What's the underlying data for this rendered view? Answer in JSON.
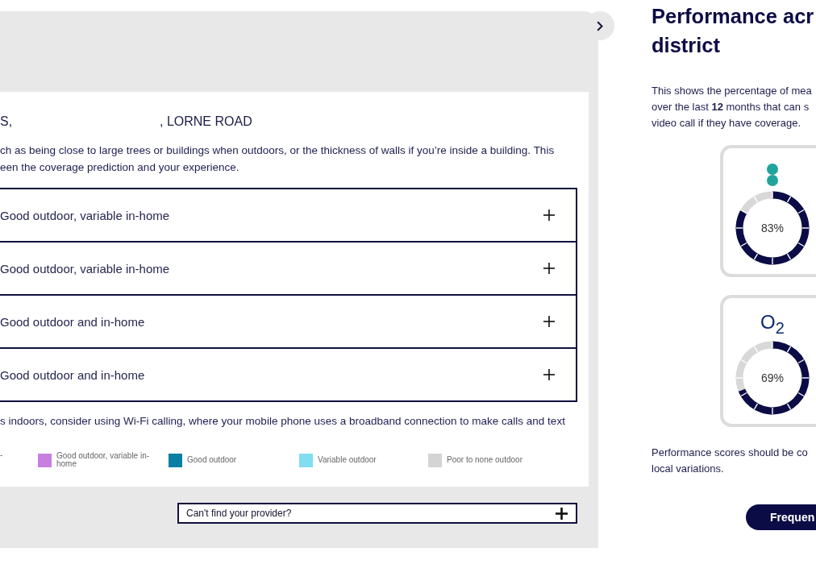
{
  "coverage_panel": {
    "address_parts": [
      "S,",
      ", LORNE ROAD"
    ],
    "intro": "ch as being close to large trees or buildings when outdoors, or the thickness of walls if you’re inside a building. This\neen the coverage prediction and your experience.",
    "providers": [
      {
        "label": "Good outdoor, variable in-home",
        "expanded": false
      },
      {
        "label": "Good outdoor, variable in-home",
        "expanded": false
      },
      {
        "label": "Good outdoor and in-home",
        "expanded": false
      },
      {
        "label": "Good outdoor and in-home",
        "expanded": false
      }
    ],
    "wifi_note": "s indoors, consider using Wi-Fi calling, where your mobile phone uses a broadband connection to make calls and text",
    "legend": [
      {
        "label": "-"
      },
      {
        "label": "Good outdoor, variable in-home",
        "color": "#c77fe0"
      },
      {
        "label": "Good outdoor",
        "color": "#0b7ea3"
      },
      {
        "label": "Variable outdoor",
        "color": "#80def0"
      },
      {
        "label": "Poor to none outdoor",
        "color": "#d4d4d4"
      }
    ],
    "provider_button": {
      "label": "Can't find your provider?",
      "expanded": false
    }
  },
  "performance": {
    "title": "Performance acr\ndistrict",
    "description": "This shows the percentage of mea\nover the last **12** months that can s\nvideo call if they have coverage.",
    "cards": [
      {
        "kind": "icon",
        "value": "83%",
        "chart_data": {
          "type": "donut",
          "values": [
            83,
            17
          ]
        }
      },
      {
        "kind": "wordmark",
        "logo": "O$_{2}$",
        "value": "69%",
        "chart_data": {
          "type": "donut",
          "values": [
            69,
            31
          ]
        }
      }
    ],
    "note": "Performance scores should be co\nlocal variations.",
    "faq_button": "Frequen"
  }
}
